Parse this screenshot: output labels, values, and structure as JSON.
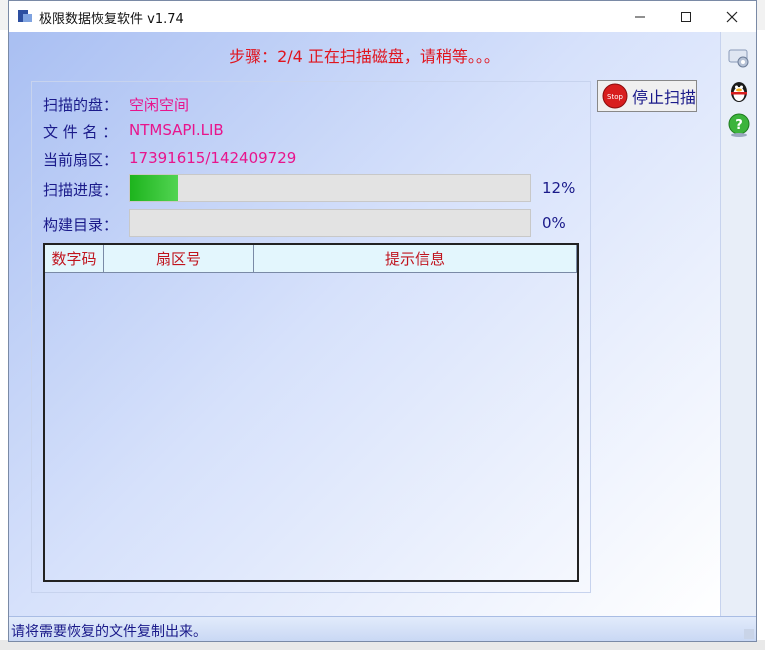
{
  "window": {
    "title": "极限数据恢复软件 v1.74"
  },
  "step": {
    "text": "步骤：2/4 正在扫描磁盘，请稍等。。。"
  },
  "info": {
    "disk_label": "扫描的盘：",
    "disk_value": "空闲空间",
    "file_label": "文 件 名 ：",
    "file_value": "NTMSAPI.LIB",
    "sector_label": "当前扇区：",
    "sector_value": "17391615/142409729"
  },
  "progress": {
    "scan_label": "扫描进度：",
    "scan_percent_text": "12%",
    "scan_fraction": 0.12,
    "build_label": "构建目录：",
    "build_percent_text": "0%",
    "build_fraction": 0
  },
  "stop_button": {
    "label": "停止扫描",
    "icon": "stop-sign-icon"
  },
  "table": {
    "columns": [
      "数字码",
      "扇区号",
      "提示信息"
    ],
    "rows": []
  },
  "sidebar": {
    "icons": [
      "network-settings-icon",
      "qq-penguin-icon",
      "help-icon"
    ]
  },
  "statusbar": {
    "text": "请将需要恢复的文件复制出来。"
  },
  "colors": {
    "step": "#e0141e",
    "value": "#e8148c",
    "label": "#1a1a8a",
    "header": "#c0141e",
    "progress": "#1db41d"
  }
}
